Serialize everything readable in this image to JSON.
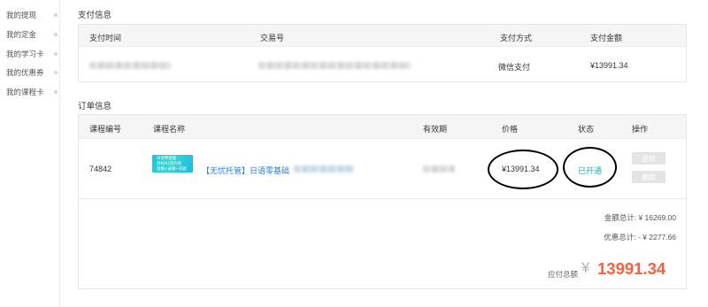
{
  "sidebar": {
    "items": [
      {
        "label": "我的提现"
      },
      {
        "label": "我的定金"
      },
      {
        "label": "我的学习卡"
      },
      {
        "label": "我的优惠券"
      },
      {
        "label": "我的课程卡"
      }
    ]
  },
  "payment": {
    "section_title": "支付信息",
    "headers": {
      "time": "支付时间",
      "trade_no": "交易号",
      "method": "支付方式",
      "amount": "支付金额"
    },
    "row": {
      "method": "微信支付",
      "amount": "¥13991.34"
    }
  },
  "order": {
    "section_title": "订单信息",
    "headers": {
      "course_no": "课程编号",
      "course_name": "课程名称",
      "validity": "有效期",
      "price": "价格",
      "status": "状态",
      "action": "操作"
    },
    "row": {
      "course_no": "74842",
      "thumbnail_lines": [
        "日语零基础",
        "目标N1签约班",
        "直播+录播+答疑"
      ],
      "course_name": "【无忧托管】日语零基础",
      "price": "¥13991.34",
      "status": "已开通",
      "refund_label": "退款",
      "delete_label": "删除"
    },
    "summary": {
      "total": "金额总计: ¥ 16269.00",
      "discount": "优惠总计: - ¥ 2277.66",
      "payable_label": "应付总额",
      "payable_currency": "¥",
      "payable_value": "13991.34"
    }
  },
  "colors": {
    "accent_status": "#2aa9b3",
    "payable": "#f06442",
    "link": "#2b7bd6"
  }
}
